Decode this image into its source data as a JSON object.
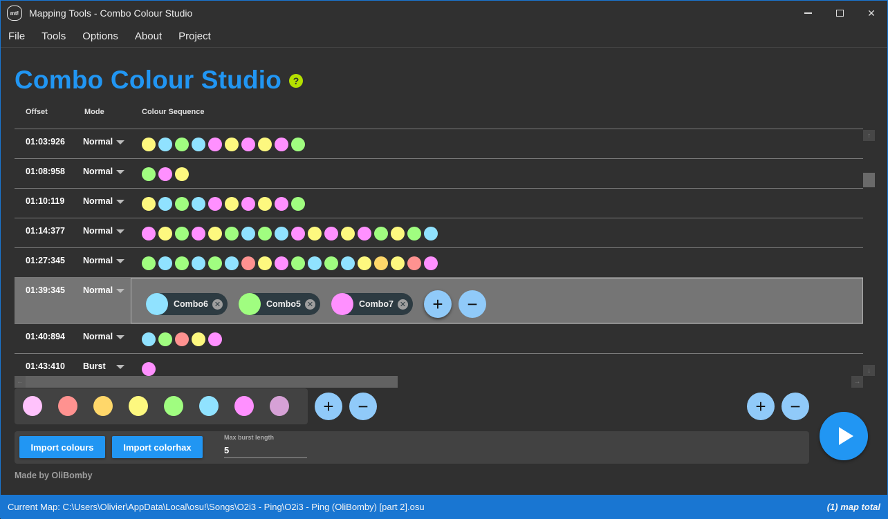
{
  "window": {
    "title": "Mapping Tools - Combo Colour Studio",
    "logo_text": "mt!",
    "controls": {
      "minimize": "minimize-icon",
      "maximize": "maximize-icon",
      "close": "✕"
    }
  },
  "menu": [
    "File",
    "Tools",
    "Options",
    "About",
    "Project"
  ],
  "page": {
    "title": "Combo Colour Studio",
    "help_icon": "?"
  },
  "colors": {
    "lightpink": "#ffc2fc",
    "red": "#ff9290",
    "orange": "#ffd76a",
    "yellow": "#fdf87f",
    "green": "#a0fd80",
    "blue": "#90e2ff",
    "pink": "#ff90ff",
    "mauve": "#d6a1d6",
    "accent": "#2196f3",
    "statusbar": "#1976d2"
  },
  "table": {
    "headers": {
      "offset": "Offset",
      "mode": "Mode",
      "sequence": "Colour Sequence"
    },
    "rows": [
      {
        "offset": "01:03:926",
        "mode": "Normal",
        "sequence": [
          "yellow",
          "blue",
          "green",
          "blue",
          "pink",
          "yellow",
          "pink",
          "yellow",
          "pink",
          "green"
        ]
      },
      {
        "offset": "01:08:958",
        "mode": "Normal",
        "sequence": [
          "green",
          "pink",
          "yellow"
        ]
      },
      {
        "offset": "01:10:119",
        "mode": "Normal",
        "sequence": [
          "yellow",
          "blue",
          "green",
          "blue",
          "pink",
          "yellow",
          "pink",
          "yellow",
          "pink",
          "green"
        ]
      },
      {
        "offset": "01:14:377",
        "mode": "Normal",
        "sequence": [
          "pink",
          "yellow",
          "green",
          "pink",
          "yellow",
          "green",
          "blue",
          "green",
          "blue",
          "pink",
          "yellow",
          "pink",
          "yellow",
          "pink",
          "green",
          "yellow",
          "green",
          "blue"
        ]
      },
      {
        "offset": "01:27:345",
        "mode": "Normal",
        "sequence": [
          "green",
          "blue",
          "green",
          "blue",
          "green",
          "blue",
          "red",
          "yellow",
          "pink",
          "green",
          "blue",
          "green",
          "blue",
          "yellow",
          "orange",
          "yellow",
          "red",
          "pink"
        ]
      },
      {
        "offset": "01:39:345",
        "mode": "Normal",
        "selected": true,
        "chips": [
          {
            "label": "Combo6",
            "color": "blue"
          },
          {
            "label": "Combo5",
            "color": "green"
          },
          {
            "label": "Combo7",
            "color": "pink"
          }
        ],
        "add_label": "+",
        "remove_label": "−"
      },
      {
        "offset": "01:40:894",
        "mode": "Normal",
        "sequence": [
          "blue",
          "green",
          "red",
          "yellow",
          "pink"
        ]
      },
      {
        "offset": "01:43:410",
        "mode": "Burst",
        "sequence": [
          "pink"
        ]
      }
    ]
  },
  "scrollbars": {
    "up": "↑",
    "down": "↓",
    "left": "←",
    "right": "→"
  },
  "palette": {
    "colors": [
      "lightpink",
      "red",
      "orange",
      "yellow",
      "green",
      "blue",
      "pink",
      "mauve"
    ],
    "add_label": "+",
    "remove_label": "−"
  },
  "right_controls": {
    "add_label": "+",
    "remove_label": "−"
  },
  "options": {
    "import_colours": "Import colours",
    "import_colorhax": "Import colorhax",
    "max_burst_label": "Max burst length",
    "max_burst_value": "5"
  },
  "run_button": "play-icon",
  "footer": {
    "made_by": "Made by OliBomby"
  },
  "status": {
    "current_map": "Current Map: C:\\Users\\Olivier\\AppData\\Local\\osu!\\Songs\\O2i3 - Ping\\O2i3 - Ping (OliBomby) [part 2].osu",
    "total": "(1) map total"
  }
}
